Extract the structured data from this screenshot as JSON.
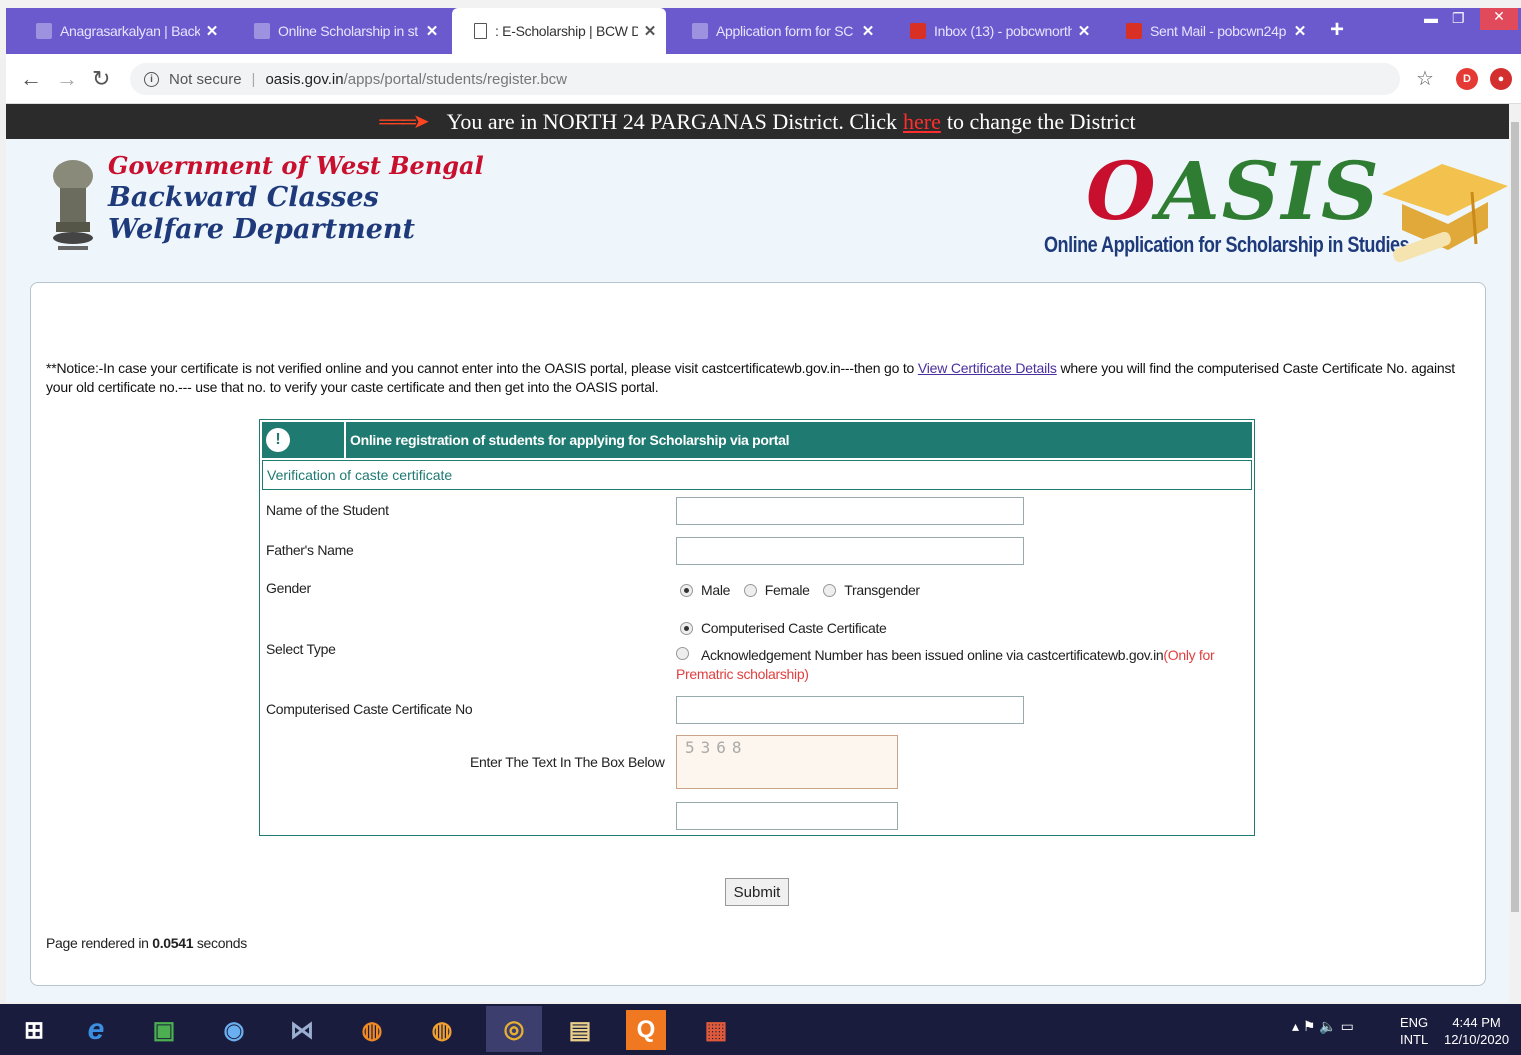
{
  "browser": {
    "tabs": [
      {
        "title": "Anagrasarkalyan | Backw",
        "active": false
      },
      {
        "title": "Online Scholarship in st",
        "active": false
      },
      {
        "title": ": E-Scholarship | BCW D",
        "active": true
      },
      {
        "title": "Application form for SC",
        "active": false
      },
      {
        "title": "Inbox (13) - pobcwnorth",
        "active": false
      },
      {
        "title": "Sent Mail - pobcwn24p",
        "active": false
      }
    ],
    "new_tab": "+",
    "security": "Not secure",
    "url_host": "oasis.gov.in",
    "url_path": "/apps/portal/students/register.bcw",
    "ext1": "D",
    "ext2": "●"
  },
  "district_bar": {
    "prefix": "You are in NORTH 24 PARGANAS District. Click",
    "link": "here",
    "suffix": "to change the District"
  },
  "header": {
    "gov": "Government of West Bengal",
    "dept_line1": "Backward Classes",
    "dept_line2": "Welfare Department",
    "logo_o": "O",
    "logo_rest": "ASIS",
    "logo_tagline": "Online Application for Scholarship in Studies"
  },
  "notice": {
    "text1": "**Notice:-In case your certificate is not verified online and you cannot enter into the OASIS portal, please visit castcertificatewb.gov.in---then go to",
    "link": "View Certificate Details",
    "text2": "where you will find the computerised Caste Certificate No. against your old certificate no.--- use that no. to verify your caste certificate and then get into the OASIS portal."
  },
  "form": {
    "heading": "Online registration of students for applying for Scholarship via portal",
    "subheading": "Verification of caste certificate",
    "student_name_label": "Name of the Student",
    "student_name_value": "",
    "father_name_label": "Father's Name",
    "father_name_value": "",
    "gender_label": "Gender",
    "gender_options": [
      "Male",
      "Female",
      "Transgender"
    ],
    "gender_selected": "Male",
    "type_label": "Select Type",
    "type_option1": "Computerised Caste Certificate",
    "type_option2": "Acknowledgement Number has been issued online via castcertificatewb.gov.in",
    "type_option2_hint": "(Only for Prematric scholarship)",
    "type_selected": "Computerised Caste Certificate",
    "cert_no_label": "Computerised Caste Certificate No",
    "cert_no_value": "",
    "captcha_label": "Enter The Text In The Box Below",
    "captcha_text": "5368",
    "captcha_value": "",
    "submit": "Submit"
  },
  "footer": {
    "rendered_prefix": "Page rendered in",
    "rendered_time": "0.0541",
    "rendered_suffix": "seconds"
  },
  "taskbar": {
    "lang1": "ENG",
    "lang2": "INTL",
    "time": "4:44 PM",
    "date": "12/10/2020"
  }
}
